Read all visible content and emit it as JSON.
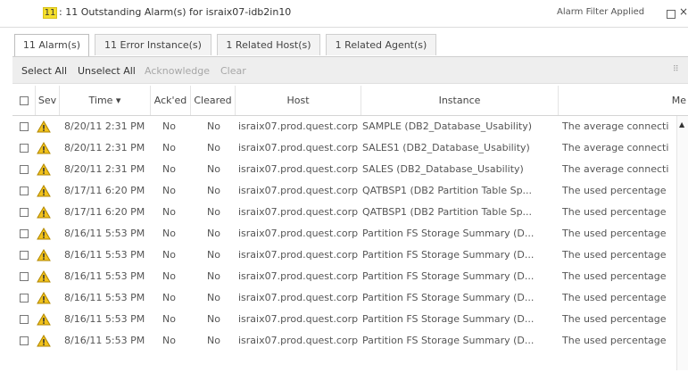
{
  "titlebar": {
    "count": "11",
    "title": ": 11 Outstanding Alarm(s) for israix07-idb2in10",
    "filter_label": "Alarm Filter  Applied",
    "close_glyph": "×"
  },
  "tabs": [
    {
      "label": "11 Alarm(s)",
      "active": true
    },
    {
      "label": "11 Error Instance(s)",
      "active": false
    },
    {
      "label": "1 Related Host(s)",
      "active": false
    },
    {
      "label": "1 Related Agent(s)",
      "active": false
    }
  ],
  "toolbar": {
    "select_all": "Select All",
    "unselect_all": "Unselect All",
    "acknowledge": "Acknowledge",
    "clear": "Clear",
    "grip": "⠿"
  },
  "columns": {
    "sev": "Sev",
    "time": "Time ▾",
    "acked": "Ack'ed",
    "cleared": "Cleared",
    "host": "Host",
    "instance": "Instance",
    "message": "Me"
  },
  "icons": {
    "severity": "warning-triangle-icon",
    "scroll_up": "▲"
  },
  "colors": {
    "warning_fill": "#f2c21b",
    "warning_stroke": "#b08600",
    "title_badge": "#f5df2b"
  },
  "rows": [
    {
      "time": "8/20/11 2:31 PM",
      "acked": "No",
      "cleared": "No",
      "host": "israix07.prod.quest.corp",
      "instance": "SAMPLE (DB2_Database_Usability)",
      "message": "The average connecti"
    },
    {
      "time": "8/20/11 2:31 PM",
      "acked": "No",
      "cleared": "No",
      "host": "israix07.prod.quest.corp",
      "instance": "SALES1 (DB2_Database_Usability)",
      "message": "The average connecti"
    },
    {
      "time": "8/20/11 2:31 PM",
      "acked": "No",
      "cleared": "No",
      "host": "israix07.prod.quest.corp",
      "instance": "SALES (DB2_Database_Usability)",
      "message": "The average connecti"
    },
    {
      "time": "8/17/11 6:20 PM",
      "acked": "No",
      "cleared": "No",
      "host": "israix07.prod.quest.corp",
      "instance": "QATBSP1 (DB2 Partition Table Sp...",
      "message": "The used percentage"
    },
    {
      "time": "8/17/11 6:20 PM",
      "acked": "No",
      "cleared": "No",
      "host": "israix07.prod.quest.corp",
      "instance": "QATBSP1 (DB2 Partition Table Sp...",
      "message": "The used percentage"
    },
    {
      "time": "8/16/11 5:53 PM",
      "acked": "No",
      "cleared": "No",
      "host": "israix07.prod.quest.corp",
      "instance": "Partition FS Storage Summary (D...",
      "message": "The used percentage"
    },
    {
      "time": "8/16/11 5:53 PM",
      "acked": "No",
      "cleared": "No",
      "host": "israix07.prod.quest.corp",
      "instance": "Partition FS Storage Summary (D...",
      "message": "The used percentage"
    },
    {
      "time": "8/16/11 5:53 PM",
      "acked": "No",
      "cleared": "No",
      "host": "israix07.prod.quest.corp",
      "instance": "Partition FS Storage Summary (D...",
      "message": "The used percentage"
    },
    {
      "time": "8/16/11 5:53 PM",
      "acked": "No",
      "cleared": "No",
      "host": "israix07.prod.quest.corp",
      "instance": "Partition FS Storage Summary (D...",
      "message": "The used percentage"
    },
    {
      "time": "8/16/11 5:53 PM",
      "acked": "No",
      "cleared": "No",
      "host": "israix07.prod.quest.corp",
      "instance": "Partition FS Storage Summary (D...",
      "message": "The used percentage"
    },
    {
      "time": "8/16/11 5:53 PM",
      "acked": "No",
      "cleared": "No",
      "host": "israix07.prod.quest.corp",
      "instance": "Partition FS Storage Summary (D...",
      "message": "The used percentage"
    }
  ]
}
